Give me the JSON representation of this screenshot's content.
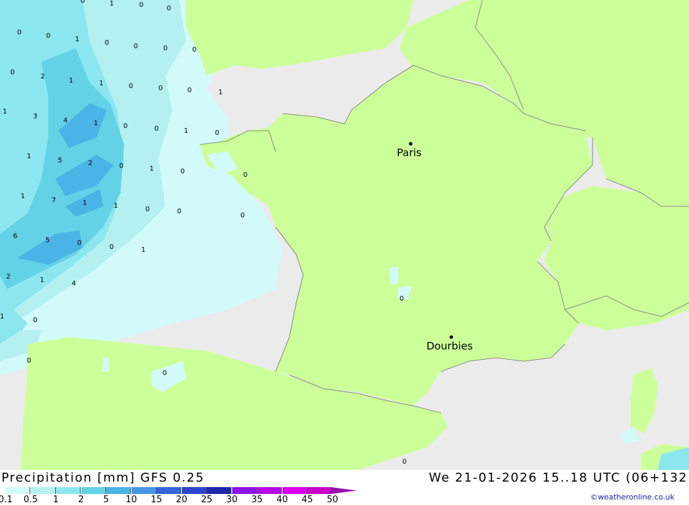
{
  "map": {
    "cities": [
      {
        "name": "Paris"
      },
      {
        "name": "Dourbies"
      }
    ],
    "values": [
      "0",
      "1",
      "0",
      "0",
      "0",
      "0",
      "1",
      "0",
      "0",
      "0",
      "0",
      "0",
      "2",
      "1",
      "1",
      "0",
      "0",
      "0",
      "1",
      "1",
      "3",
      "4",
      "1",
      "0",
      "0",
      "1",
      "0",
      "1",
      "5",
      "2",
      "0",
      "1",
      "0",
      "0",
      "1",
      "7",
      "1",
      "1",
      "0",
      "0",
      "0",
      "6",
      "5",
      "0",
      "0",
      "1",
      "2",
      "1",
      "4",
      "1",
      "0",
      "0",
      "0",
      "0",
      "0"
    ]
  },
  "footer": {
    "title_left": "Precipitation [mm] GFS 0.25",
    "title_right": "We 21-01-2026 15..18 UTC (06+132",
    "credit": "©weatheronline.co.uk"
  },
  "legend": {
    "labels": [
      "0.1",
      "0.5",
      "1",
      "2",
      "5",
      "10",
      "15",
      "20",
      "25",
      "30",
      "35",
      "40",
      "45",
      "50"
    ],
    "colors": [
      "#d2fafa",
      "#b4f0f0",
      "#8ce6f0",
      "#64d2e6",
      "#4bb4e6",
      "#4696e6",
      "#3264dc",
      "#2846c8",
      "#1e28aa",
      "#8c14e6",
      "#b40ae6",
      "#dc00f0",
      "#c800c8"
    ]
  },
  "colors": {
    "land": "#ccff99",
    "sea": "#ebebeb",
    "precip_light": "#d2fafa",
    "precip_mid": "#8ce6f0",
    "precip_heavy": "#4bb4e6"
  }
}
